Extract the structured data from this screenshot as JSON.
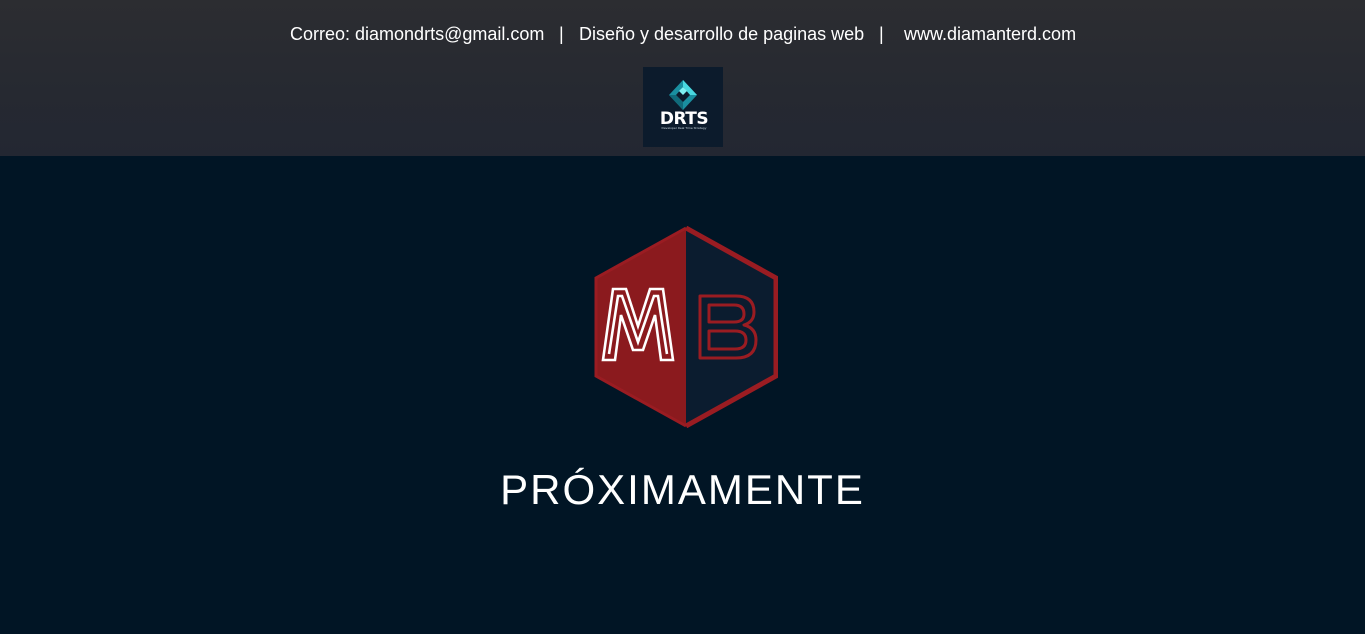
{
  "header": {
    "email_text": "Correo: diamondrts@gmail.com",
    "separator": "|",
    "tagline": "Diseño y desarrollo de paginas web",
    "website": "www.diamanterd.com",
    "logo": {
      "icon": "diamond-logo-icon",
      "text": "DRTS",
      "subtext": "Developer Real Time Strategy",
      "accent_color": "#3bc6d0",
      "text_color": "#ffffff"
    }
  },
  "main": {
    "logo": {
      "icon": "mb-hexagon-logo-icon",
      "letters": "MB",
      "primary_color": "#8b1a1e",
      "dark_color": "#0c1e33"
    },
    "coming_soon": "PRÓXIMAMENTE"
  },
  "colors": {
    "header_bg": "#26292f",
    "page_bg": "#011525"
  }
}
